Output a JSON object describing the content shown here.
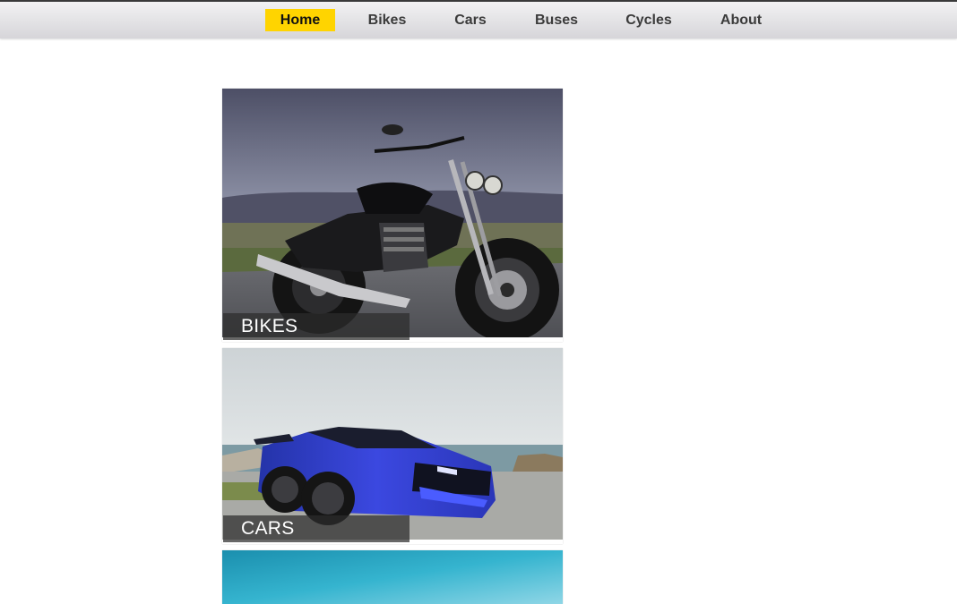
{
  "nav": {
    "items": [
      {
        "label": "Home",
        "active": true
      },
      {
        "label": "Bikes",
        "active": false
      },
      {
        "label": "Cars",
        "active": false
      },
      {
        "label": "Buses",
        "active": false
      },
      {
        "label": "Cycles",
        "active": false
      },
      {
        "label": "About",
        "active": false
      }
    ],
    "active_color": "#ffd400"
  },
  "cards": [
    {
      "caption": "BIKES",
      "image": "motorcycle-photo"
    },
    {
      "caption": "CARS",
      "image": "sports-car-photo"
    },
    {
      "caption": "",
      "image": "sky-photo"
    }
  ]
}
